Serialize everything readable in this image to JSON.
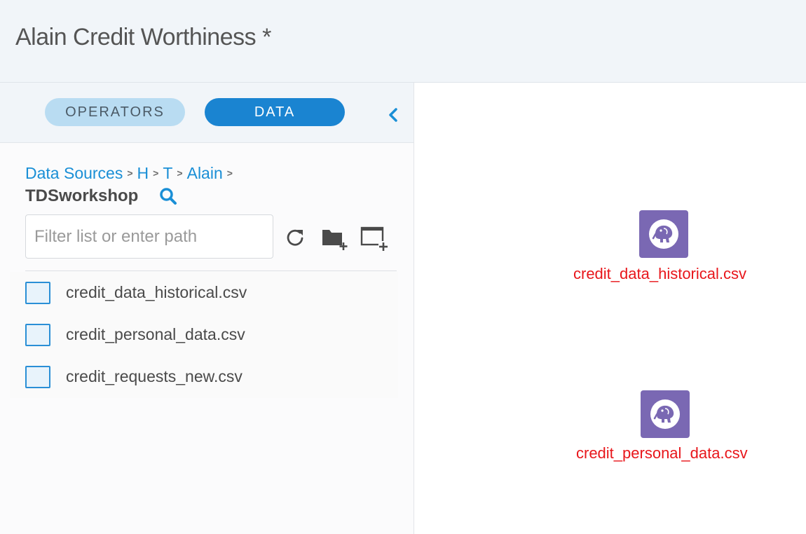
{
  "header": {
    "title": "Alain Credit Worthiness *"
  },
  "panel": {
    "tabs": {
      "operators": "OPERATORS",
      "data": "DATA"
    },
    "breadcrumb": [
      {
        "label": "Data Sources"
      },
      {
        "label": "H"
      },
      {
        "label": "T"
      },
      {
        "label": "Alain"
      }
    ],
    "current_folder": "TDSworkshop",
    "filter": {
      "value": "",
      "placeholder": "Filter list or enter path"
    },
    "files": [
      {
        "name": "credit_data_historical.csv"
      },
      {
        "name": "credit_personal_data.csv"
      },
      {
        "name": "credit_requests_new.csv"
      }
    ]
  },
  "canvas": {
    "nodes": [
      {
        "label": "credit_data_historical.csv",
        "icon": "hadoop-elephant-icon"
      },
      {
        "label": "credit_personal_data.csv",
        "icon": "hadoop-elephant-icon"
      }
    ]
  },
  "colors": {
    "accent": "#1a84d1",
    "node_icon": "#7a68b3",
    "node_label": "#e8161b",
    "header_bg": "#f1f5f9"
  }
}
